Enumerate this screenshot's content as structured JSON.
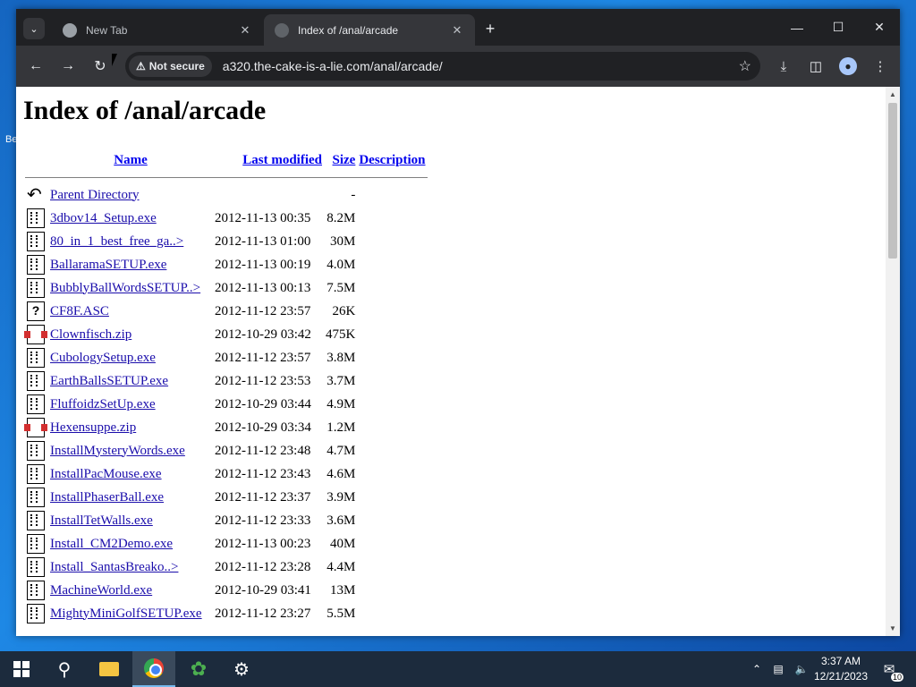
{
  "browser": {
    "tabs": [
      {
        "title": "New Tab",
        "active": false
      },
      {
        "title": "Index of /anal/arcade",
        "active": true
      }
    ],
    "security_label": "Not secure",
    "url": "a320.the-cake-is-a-lie.com/anal/arcade/"
  },
  "page": {
    "heading": "Index of /anal/arcade",
    "columns": {
      "name": "Name",
      "modified": "Last modified",
      "size": "Size",
      "description": "Description"
    },
    "parent": {
      "name": "Parent Directory",
      "size": "-"
    },
    "files": [
      {
        "icon": "binary-file-icon",
        "name": "3dbov14_Setup.exe",
        "modified": "2012-11-13 00:35",
        "size": "8.2M"
      },
      {
        "icon": "binary-file-icon",
        "name": "80_in_1_best_free_ga..>",
        "modified": "2012-11-13 01:00",
        "size": "30M"
      },
      {
        "icon": "binary-file-icon",
        "name": "BallaramaSETUP.exe",
        "modified": "2012-11-13 00:19",
        "size": "4.0M"
      },
      {
        "icon": "binary-file-icon",
        "name": "BubblyBallWordsSETUP..>",
        "modified": "2012-11-13 00:13",
        "size": "7.5M"
      },
      {
        "icon": "unknown-file-icon",
        "name": "CF8F.ASC",
        "modified": "2012-11-12 23:57",
        "size": "26K"
      },
      {
        "icon": "compressed-file-icon",
        "name": "Clownfisch.zip",
        "modified": "2012-10-29 03:42",
        "size": "475K"
      },
      {
        "icon": "binary-file-icon",
        "name": "CubologySetup.exe",
        "modified": "2012-11-12 23:57",
        "size": "3.8M"
      },
      {
        "icon": "binary-file-icon",
        "name": "EarthBallsSETUP.exe",
        "modified": "2012-11-12 23:53",
        "size": "3.7M"
      },
      {
        "icon": "binary-file-icon",
        "name": "FluffoidzSetUp.exe",
        "modified": "2012-10-29 03:44",
        "size": "4.9M"
      },
      {
        "icon": "compressed-file-icon",
        "name": "Hexensuppe.zip",
        "modified": "2012-10-29 03:34",
        "size": "1.2M"
      },
      {
        "icon": "binary-file-icon",
        "name": "InstallMysteryWords.exe",
        "modified": "2012-11-12 23:48",
        "size": "4.7M"
      },
      {
        "icon": "binary-file-icon",
        "name": "InstallPacMouse.exe",
        "modified": "2012-11-12 23:43",
        "size": "4.6M"
      },
      {
        "icon": "binary-file-icon",
        "name": "InstallPhaserBall.exe",
        "modified": "2012-11-12 23:37",
        "size": "3.9M"
      },
      {
        "icon": "binary-file-icon",
        "name": "InstallTetWalls.exe",
        "modified": "2012-11-12 23:33",
        "size": "3.6M"
      },
      {
        "icon": "binary-file-icon",
        "name": "Install_CM2Demo.exe",
        "modified": "2012-11-13 00:23",
        "size": "40M"
      },
      {
        "icon": "binary-file-icon",
        "name": "Install_SantasBreako..>",
        "modified": "2012-11-12 23:28",
        "size": "4.4M"
      },
      {
        "icon": "binary-file-icon",
        "name": "MachineWorld.exe",
        "modified": "2012-10-29 03:41",
        "size": "13M"
      },
      {
        "icon": "binary-file-icon",
        "name": "MightyMiniGolfSETUP.exe",
        "modified": "2012-11-12 23:27",
        "size": "5.5M"
      }
    ]
  },
  "taskbar": {
    "time": "3:37 AM",
    "date": "12/21/2023",
    "notification_count": "10"
  },
  "desktop": {
    "icon_label_fragment": "Be"
  }
}
